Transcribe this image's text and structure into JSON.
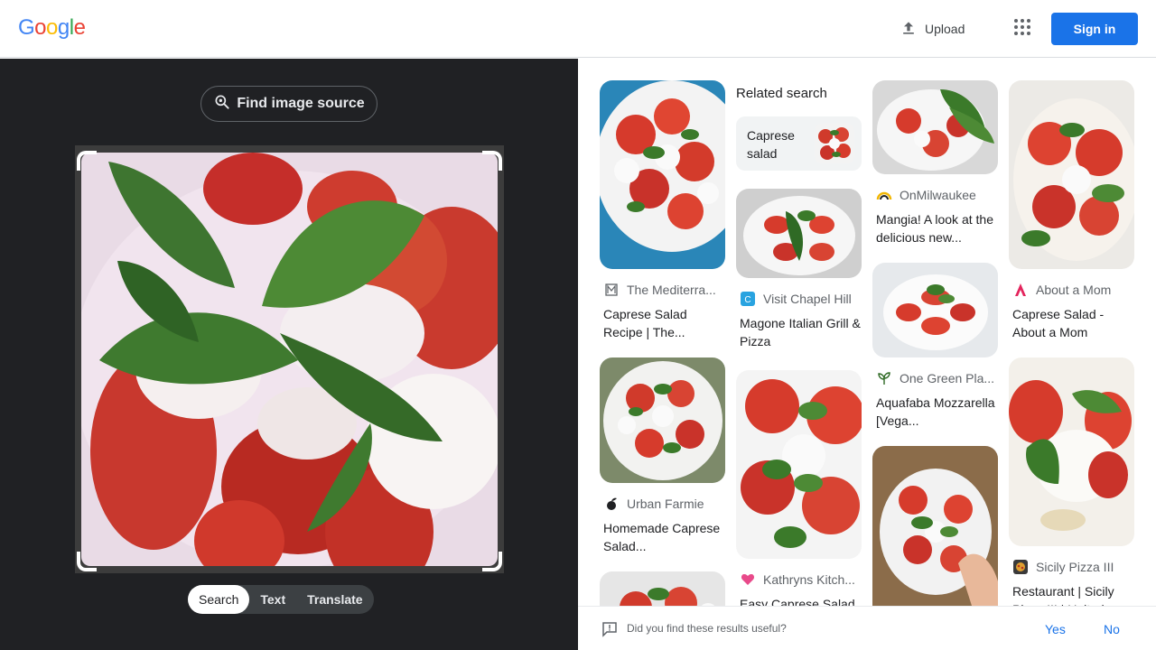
{
  "header": {
    "logo_letters": [
      "G",
      "o",
      "o",
      "g",
      "l",
      "e"
    ],
    "logo_colors": [
      "#4285f4",
      "#ea4335",
      "#fbbc05",
      "#4285f4",
      "#34a853",
      "#ea4335"
    ],
    "upload_label": "Upload",
    "signin_label": "Sign in"
  },
  "lens": {
    "find_source_label": "Find image source",
    "tabs": [
      {
        "label": "Search",
        "active": true
      },
      {
        "label": "Text",
        "active": false
      },
      {
        "label": "Translate",
        "active": false
      }
    ]
  },
  "related": {
    "title": "Related search",
    "chip_label": "Caprese salad"
  },
  "results": [
    {
      "source": "The Mediterra...",
      "title": "Caprese Salad Recipe | The...",
      "icon": "book-icon"
    },
    {
      "source": "Urban Farmie",
      "title": "Homemade Caprese Salad...",
      "icon": "leaf-icon"
    },
    {
      "source": "Visit Chapel Hill",
      "title": "Magone Italian Grill & Pizza",
      "icon": "c-logo-icon"
    },
    {
      "source": "Kathryns Kitch...",
      "title": "Easy Caprese Salad",
      "icon": "heart-icon"
    },
    {
      "source": "OnMilwaukee",
      "title": "Mangia! A look at the delicious new...",
      "icon": "rainbow-icon"
    },
    {
      "source": "One Green Pla...",
      "title": "Aquafaba Mozzarella [Vega...",
      "icon": "plant-icon"
    },
    {
      "source": "About a Mom",
      "title": "Caprese Salad - About a Mom",
      "icon": "a-logo-icon"
    },
    {
      "source": "Sicily Pizza III",
      "title": "Restaurant | Sicily Pizza III | United...",
      "icon": "pizza-icon"
    }
  ],
  "feedback": {
    "question": "Did you find these results useful?",
    "yes": "Yes",
    "no": "No"
  }
}
